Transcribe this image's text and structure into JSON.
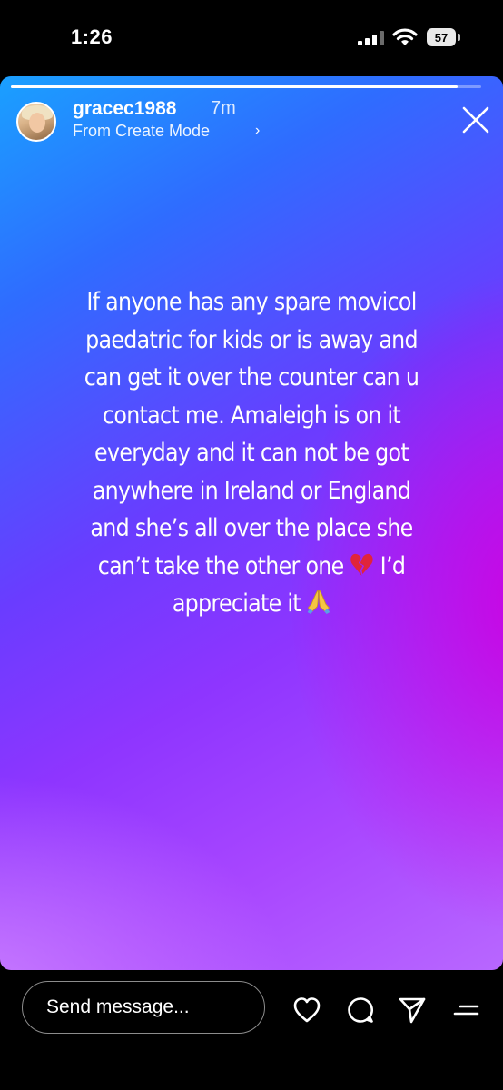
{
  "status_bar": {
    "time": "1:26",
    "battery": "57"
  },
  "story": {
    "progress": 0.95,
    "username": "gracec1988",
    "time_ago": "7m",
    "create_mode": "From Create Mode",
    "text_lines": [
      "If anyone has any spare movicol",
      "paedatric for kids or is away and",
      "can get it over the counter can u",
      "contact me. Amaleigh is on it",
      "everyday and it can not be got",
      "anywhere in Ireland or England",
      "and she’s all over the place she",
      "can’t take the other one",
      "I’d",
      "appreciate it"
    ],
    "emojis": [
      "broken-heart",
      "folded-hands"
    ]
  },
  "footer": {
    "message_placeholder": "Send message..."
  },
  "colors": {
    "gradient_top": "#1aa0ff",
    "gradient_mid": "#8e35ff",
    "gradient_right": "#cd00e1",
    "gradient_bottom": "#c47dff"
  },
  "icons": [
    "signal-icon",
    "wifi-icon",
    "battery-icon",
    "close-icon",
    "heart-icon",
    "comment-icon",
    "send-icon",
    "menu-icon"
  ]
}
